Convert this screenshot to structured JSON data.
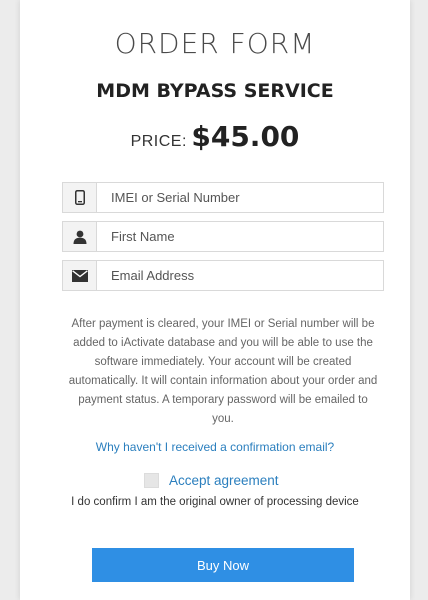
{
  "form": {
    "title": "ORDER FORM",
    "service": "MDM BYPASS SERVICE",
    "price_label": "PRICE:",
    "price_value": "$45.00"
  },
  "fields": [
    {
      "icon": "phone-icon",
      "placeholder": "IMEI or Serial Number"
    },
    {
      "icon": "user-icon",
      "placeholder": "First Name"
    },
    {
      "icon": "envelope-icon",
      "placeholder": "Email Address"
    }
  ],
  "info_text": "After payment is cleared, your IMEI or Serial number will be added to iActivate database and you will be able to use the software immediately. Your account will be created automatically. It will contain information about your order and payment status. A temporary password will be emailed to you.",
  "help_link": "Why haven't I received a confirmation email?",
  "agreement": {
    "label": "Accept agreement",
    "checked": false,
    "confirm_text": "I do confirm I am the original owner of processing device"
  },
  "buy_button": "Buy Now",
  "colors": {
    "accent": "#2f8fe4",
    "link": "#2b7fbe",
    "icon": "#333333"
  }
}
